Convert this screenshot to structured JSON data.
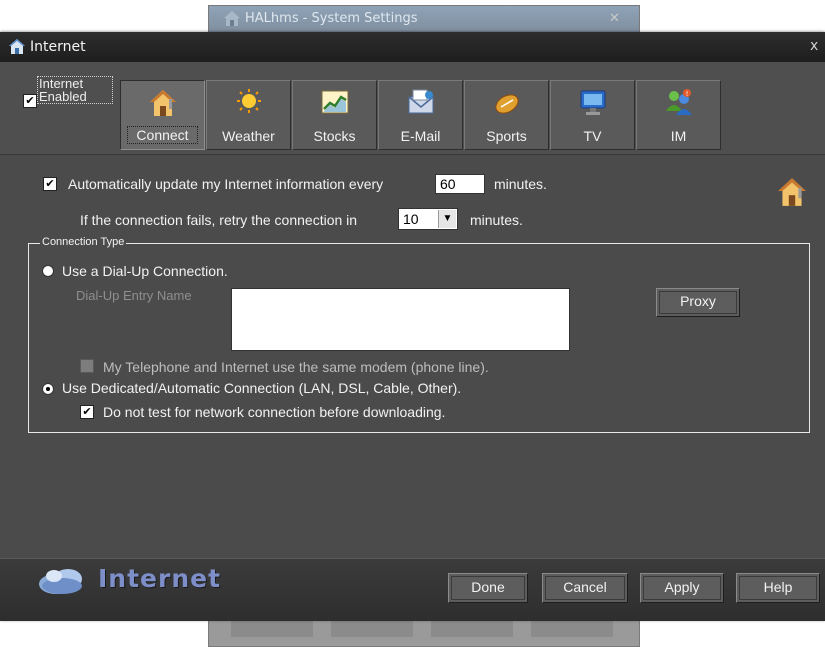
{
  "background_window": {
    "title": "HALhms - System Settings",
    "close_glyph": "✕"
  },
  "window": {
    "title": "Internet",
    "close_glyph": "x"
  },
  "toolbar": {
    "internet_enabled": {
      "checked": true,
      "label": "Internet Enabled"
    },
    "tabs": [
      {
        "label": "Connect",
        "icon": "house-icon",
        "active": true
      },
      {
        "label": "Weather",
        "icon": "sun-icon",
        "active": false
      },
      {
        "label": "Stocks",
        "icon": "stock-chart-icon",
        "active": false
      },
      {
        "label": "E-Mail",
        "icon": "mail-icon",
        "active": false
      },
      {
        "label": "Sports",
        "icon": "football-icon",
        "active": false
      },
      {
        "label": "TV",
        "icon": "tv-icon",
        "active": false
      },
      {
        "label": "IM",
        "icon": "im-people-icon",
        "active": false
      }
    ]
  },
  "connect": {
    "auto_update": {
      "checked": true,
      "label": "Automatically update my Internet information every",
      "minutes_value": "60",
      "suffix": "minutes."
    },
    "retry": {
      "label": "If the connection fails, retry the connection in",
      "value": "10",
      "suffix": "minutes."
    },
    "connection_type": {
      "group_label": "Connection Type",
      "dialup": {
        "selected": false,
        "label": "Use a Dial-Up Connection.",
        "entry_label": "Dial-Up Entry Name",
        "entry_value": "",
        "proxy_label": "Proxy"
      },
      "same_modem": {
        "checked": false,
        "enabled": false,
        "label": "My Telephone and Internet use the same modem (phone line)."
      },
      "dedicated": {
        "selected": true,
        "label": "Use Dedicated/Automatic Connection (LAN, DSL, Cable, Other)."
      },
      "no_test": {
        "checked": true,
        "label": "Do not test for network connection before downloading."
      }
    }
  },
  "footer": {
    "title": "Internet",
    "buttons": {
      "done": "Done",
      "cancel": "Cancel",
      "apply": "Apply",
      "help": "Help"
    }
  },
  "colors": {
    "window_bg": "#4b4b4b",
    "titlebar": "#222222",
    "footer_title": "#7e8ec8",
    "background": "#ffffff"
  }
}
